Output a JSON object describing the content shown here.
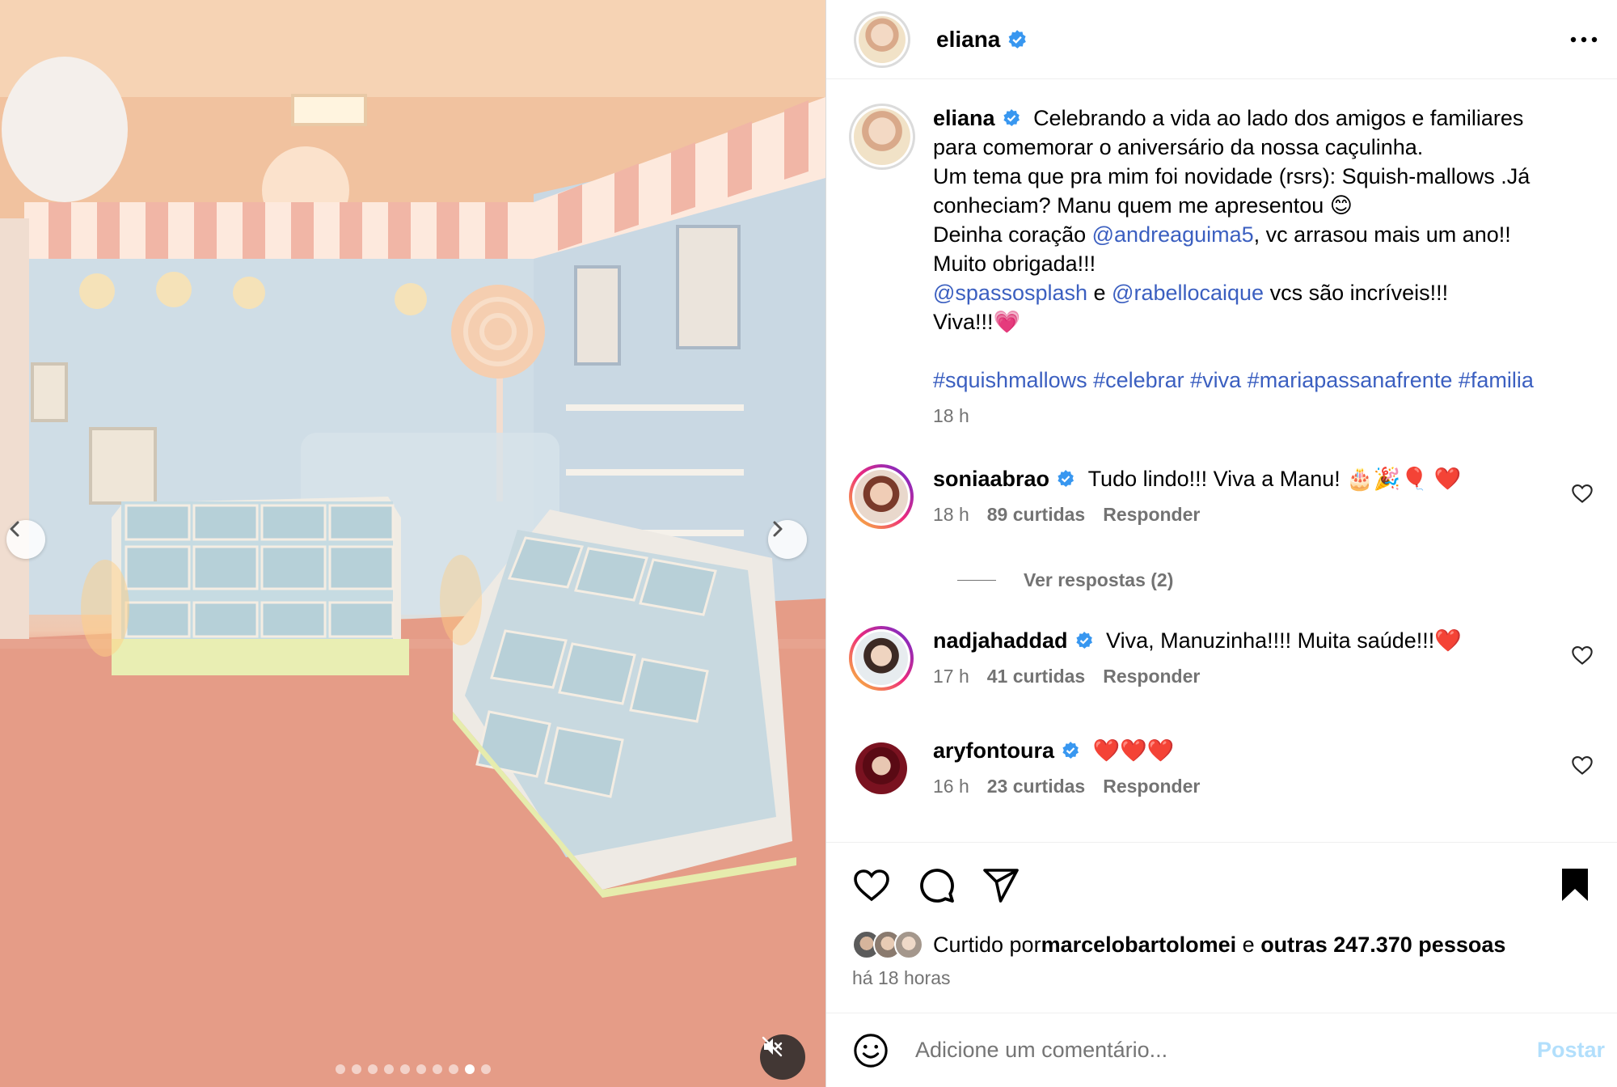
{
  "post": {
    "username": "eliana",
    "more_icon": "ellipsis-icon"
  },
  "caption": {
    "username": "eliana",
    "lines": [
      "Celebrando a vida ao lado dos amigos e familiares",
      "para comemorar o aniversário da nossa caçulinha.",
      "Um tema que pra mim foi novidade (rsrs): Squish-mallows .Já",
      "conheciam? Manu quem me apresentou 😊"
    ],
    "line5_pre": "Deinha coração ",
    "line5_mention": "@andreaguima5",
    "line5_post": ", vc arrasou mais um ano!!",
    "line6": "Muito obrigada!!!",
    "line7_mention1": "@spassosplash",
    "line7_mid": " e ",
    "line7_mention2": "@rabellocaique",
    "line7_post": " vcs são incríveis!!!",
    "line8": "Viva!!!💗",
    "hashtags": "#squishmallows #celebrar #viva #mariapassanafrente #familia",
    "time": "18 h"
  },
  "comments": [
    {
      "username": "soniaabrao",
      "text": "Tudo lindo!!! Viva a Manu! 🎂🎉🎈 ❤️",
      "time": "18 h",
      "likes": "89 curtidas",
      "reply": "Responder"
    },
    {
      "username": "nadjahaddad",
      "text": "Viva, Manuzinha!!!! Muita saúde!!!❤️",
      "time": "17 h",
      "likes": "41 curtidas",
      "reply": "Responder"
    },
    {
      "username": "aryfontoura",
      "text": "❤️❤️❤️",
      "time": "16 h",
      "likes": "23 curtidas",
      "reply": "Responder"
    }
  ],
  "view_replies": "Ver respostas (2)",
  "likes": {
    "prefix": "Curtido por ",
    "user": "marcelobartolomei",
    "mid": " e ",
    "others": "outras 247.370 pessoas"
  },
  "posted_ago": "há 18 horas",
  "comment_box": {
    "placeholder": "Adicione um comentário...",
    "post_label": "Postar"
  },
  "carousel": {
    "count": 10,
    "active_index": 8
  },
  "colors": {
    "link": "#3b5fc0",
    "verified": "#3897f0",
    "post_button": "#b2dffc"
  }
}
